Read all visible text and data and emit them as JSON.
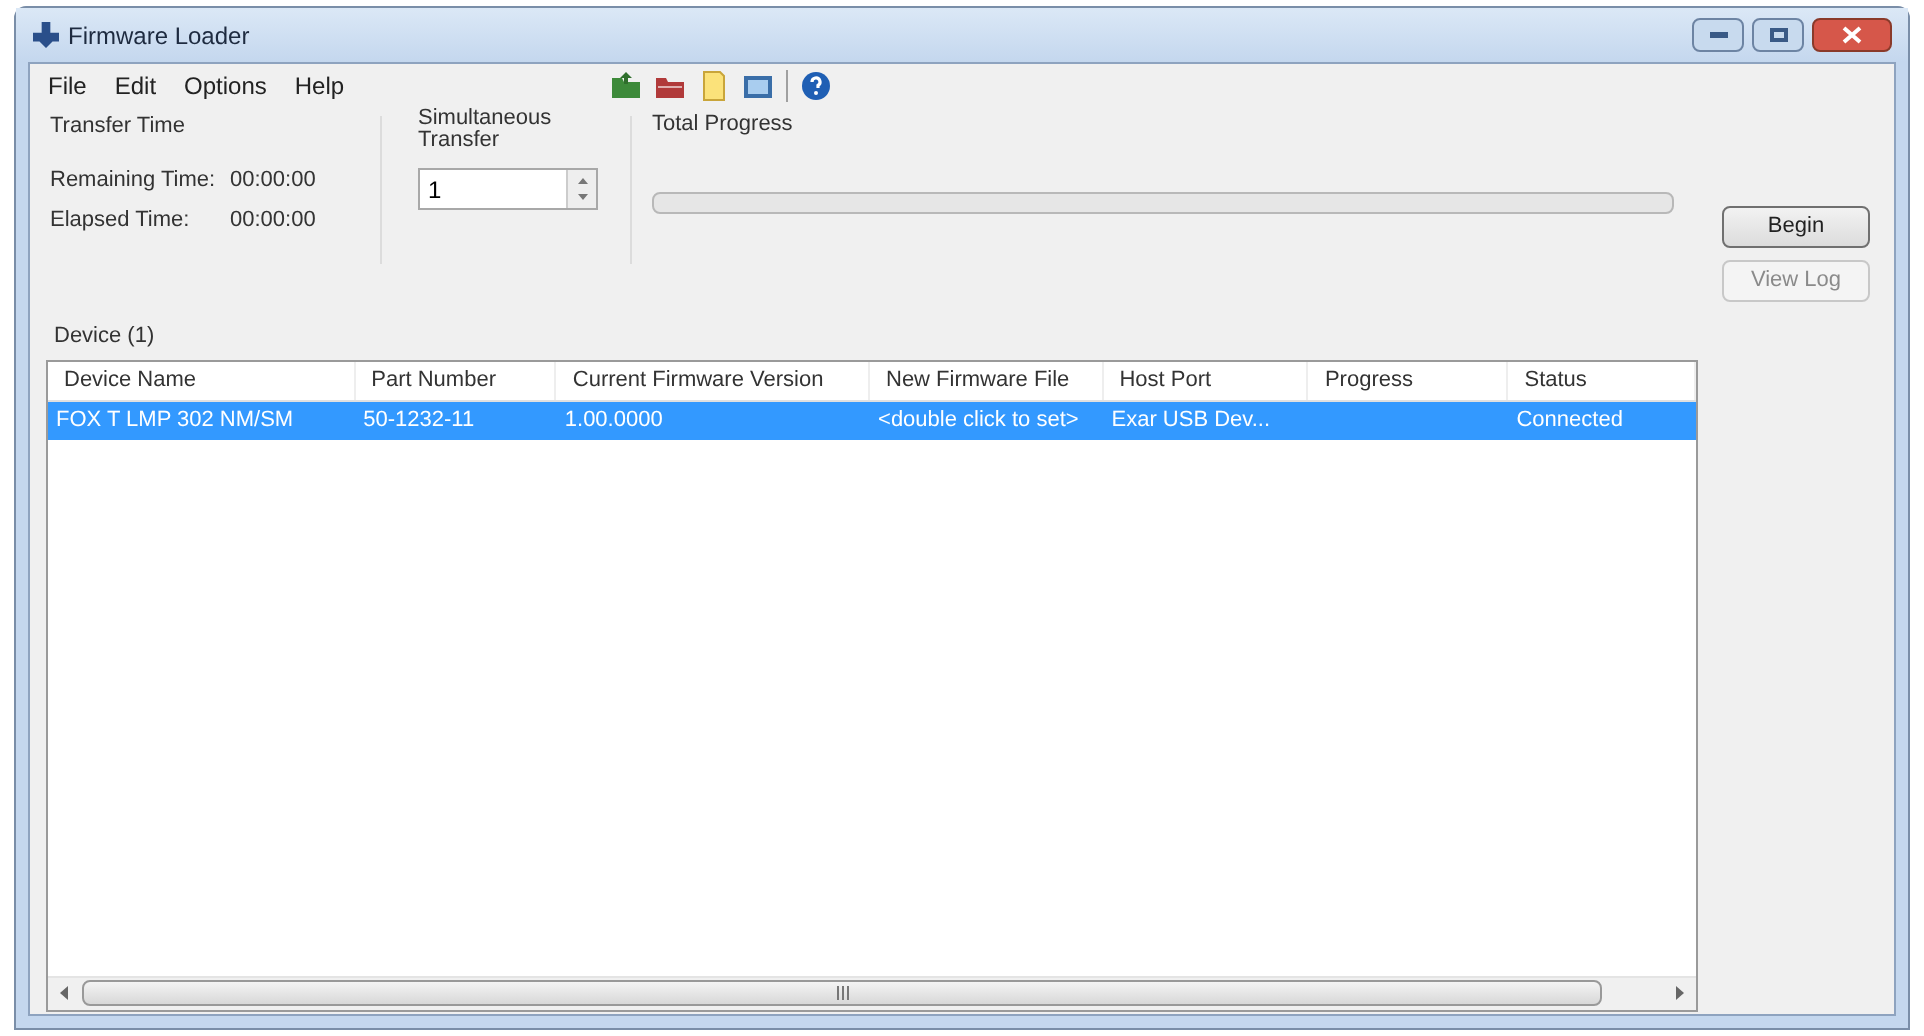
{
  "window": {
    "title": "Firmware Loader"
  },
  "menu": [
    {
      "label": "File"
    },
    {
      "label": "Edit"
    },
    {
      "label": "Options"
    },
    {
      "label": "Help"
    }
  ],
  "toolbar": [
    {
      "kind": "green-folder"
    },
    {
      "kind": "red-folder"
    },
    {
      "kind": "note"
    },
    {
      "kind": "image"
    },
    {
      "kind": "separator"
    },
    {
      "kind": "help"
    }
  ],
  "transfer_time": {
    "title": "Transfer Time",
    "rows": [
      {
        "label": "Remaining Time:",
        "value": "00:00:00"
      },
      {
        "label": "Elapsed Time:",
        "value": "00:00:00"
      }
    ]
  },
  "simultaneous_transfer": {
    "title": "Simultaneous Transfer",
    "value": "1"
  },
  "total_progress": {
    "title": "Total Progress",
    "level": 0
  },
  "buttons": [
    {
      "label": "Begin",
      "disabled": false
    },
    {
      "label": "View Log",
      "disabled": true
    }
  ],
  "device_list": {
    "title": "Device (1)",
    "columns": [
      "Device Name",
      "Part Number",
      "Current Firmware Version",
      "New Firmware File",
      "Host Port",
      "Progress",
      "Status"
    ],
    "rows": [
      {
        "selected": true,
        "cells": [
          "FOX T LMP 302 NM/SM",
          "50-1232-11",
          "1.00.0000",
          "<double click to set>",
          "Exar USB Dev...",
          "",
          "Connected"
        ]
      }
    ]
  }
}
